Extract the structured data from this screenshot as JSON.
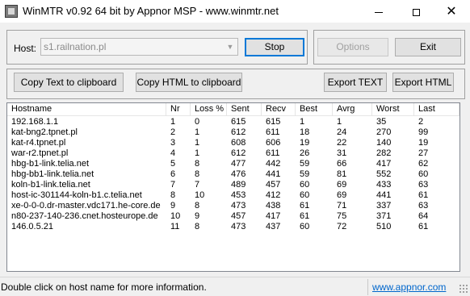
{
  "window": {
    "title": "WinMTR v0.92 64 bit by Appnor MSP - www.winmtr.net",
    "minimize_glyph": "",
    "maximize_glyph": "",
    "close_glyph": "✕"
  },
  "host": {
    "label": "Host:",
    "value": "s1.railnation.pl",
    "dropdown_glyph": "▼"
  },
  "buttons": {
    "stop": "Stop",
    "options": "Options",
    "exit": "Exit",
    "copy_text": "Copy Text to clipboard",
    "copy_html": "Copy HTML to clipboard",
    "export_text": "Export TEXT",
    "export_html": "Export HTML"
  },
  "table": {
    "columns": [
      "Hostname",
      "Nr",
      "Loss %",
      "Sent",
      "Recv",
      "Best",
      "Avrg",
      "Worst",
      "Last"
    ],
    "rows": [
      [
        "192.168.1.1",
        "1",
        "0",
        "615",
        "615",
        "1",
        "1",
        "35",
        "2"
      ],
      [
        "kat-bng2.tpnet.pl",
        "2",
        "1",
        "612",
        "611",
        "18",
        "24",
        "270",
        "99"
      ],
      [
        "kat-r4.tpnet.pl",
        "3",
        "1",
        "608",
        "606",
        "19",
        "22",
        "140",
        "19"
      ],
      [
        "war-r2.tpnet.pl",
        "4",
        "1",
        "612",
        "611",
        "26",
        "31",
        "282",
        "27"
      ],
      [
        "hbg-b1-link.telia.net",
        "5",
        "8",
        "477",
        "442",
        "59",
        "66",
        "417",
        "62"
      ],
      [
        "hbg-bb1-link.telia.net",
        "6",
        "8",
        "476",
        "441",
        "59",
        "81",
        "552",
        "60"
      ],
      [
        "koln-b1-link.telia.net",
        "7",
        "7",
        "489",
        "457",
        "60",
        "69",
        "433",
        "63"
      ],
      [
        "host-ic-301144-koln-b1.c.telia.net",
        "8",
        "10",
        "453",
        "412",
        "60",
        "69",
        "441",
        "61"
      ],
      [
        "xe-0-0-0.dr-master.vdc171.he-core.de",
        "9",
        "8",
        "473",
        "438",
        "61",
        "71",
        "337",
        "63"
      ],
      [
        "n80-237-140-236.cnet.hosteurope.de",
        "10",
        "9",
        "457",
        "417",
        "61",
        "75",
        "371",
        "64"
      ],
      [
        "146.0.5.21",
        "11",
        "8",
        "473",
        "437",
        "60",
        "72",
        "510",
        "61"
      ]
    ]
  },
  "status": {
    "message": "Double click on host name for more information.",
    "link": "www.appnor.com"
  }
}
